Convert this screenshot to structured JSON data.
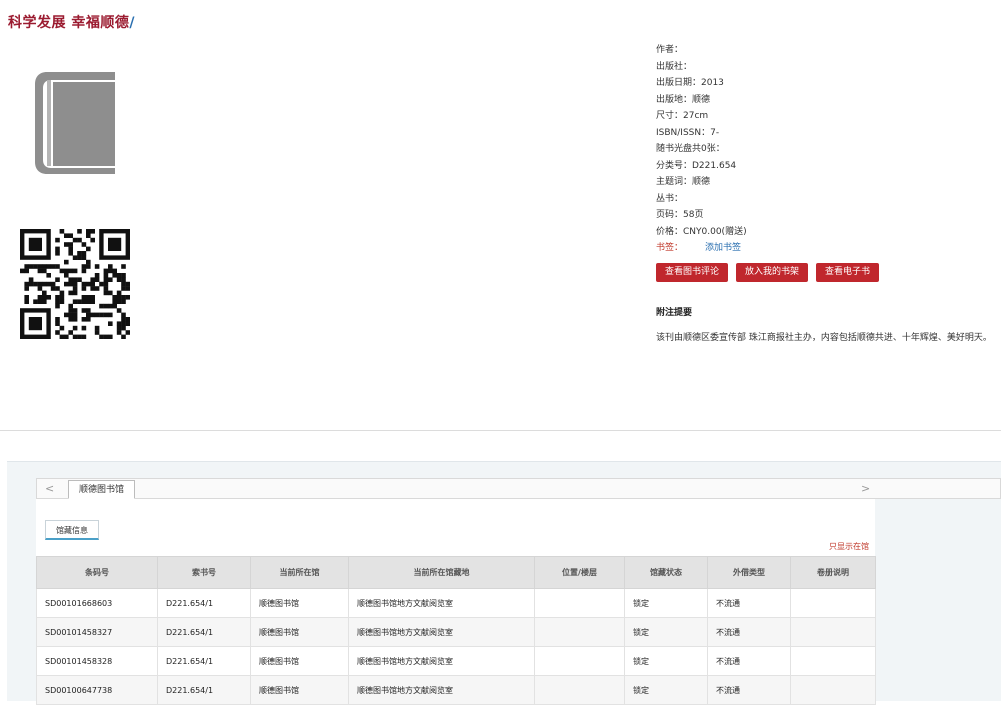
{
  "page_title": {
    "main": "科学发展 幸福顺德",
    "slash": "/"
  },
  "book": {
    "meta_rows": [
      "作者：",
      "出版社：",
      "出版日期：2013",
      "出版地：顺德",
      "尺寸：27cm",
      "ISBN/ISSN：7-",
      "随书光盘共0张：",
      "分类号：D221.654",
      "主题词：顺德",
      "丛书：",
      "页码：58页",
      "价格：CNY0.00(赠送)"
    ],
    "tags_label": "书签：",
    "add_tag_link": "添加书签",
    "buttons": {
      "review": "查看图书评论",
      "shelf": "放入我的书架",
      "ebook": "查看电子书"
    },
    "notes_title": "附注提要",
    "notes_text": "该刊由顺德区委宣传部 珠江商报社主办，内容包括顺德共进、十年辉煌、美好明天。"
  },
  "library_tabs": {
    "prev": "<",
    "next": ">",
    "active_tab": "顺德图书馆"
  },
  "holdings": {
    "subtab": "馆藏信息",
    "filter_link": "只显示在馆",
    "columns": [
      "条码号",
      "索书号",
      "当前所在馆",
      "当前所在馆藏地",
      "位置/楼层",
      "馆藏状态",
      "外借类型",
      "卷册说明"
    ],
    "rows": [
      [
        "SD00101668603",
        "D221.654/1",
        "顺德图书馆",
        "顺德图书馆地方文献阅览室",
        "",
        "锁定",
        "不流通",
        ""
      ],
      [
        "SD00101458327",
        "D221.654/1",
        "顺德图书馆",
        "顺德图书馆地方文献阅览室",
        "",
        "锁定",
        "不流通",
        ""
      ],
      [
        "SD00101458328",
        "D221.654/1",
        "顺德图书馆",
        "顺德图书馆地方文献阅览室",
        "",
        "锁定",
        "不流通",
        ""
      ],
      [
        "SD00100647738",
        "D221.654/1",
        "顺德图书馆",
        "顺德图书馆地方文献阅览室",
        "",
        "锁定",
        "不流通",
        ""
      ]
    ]
  }
}
